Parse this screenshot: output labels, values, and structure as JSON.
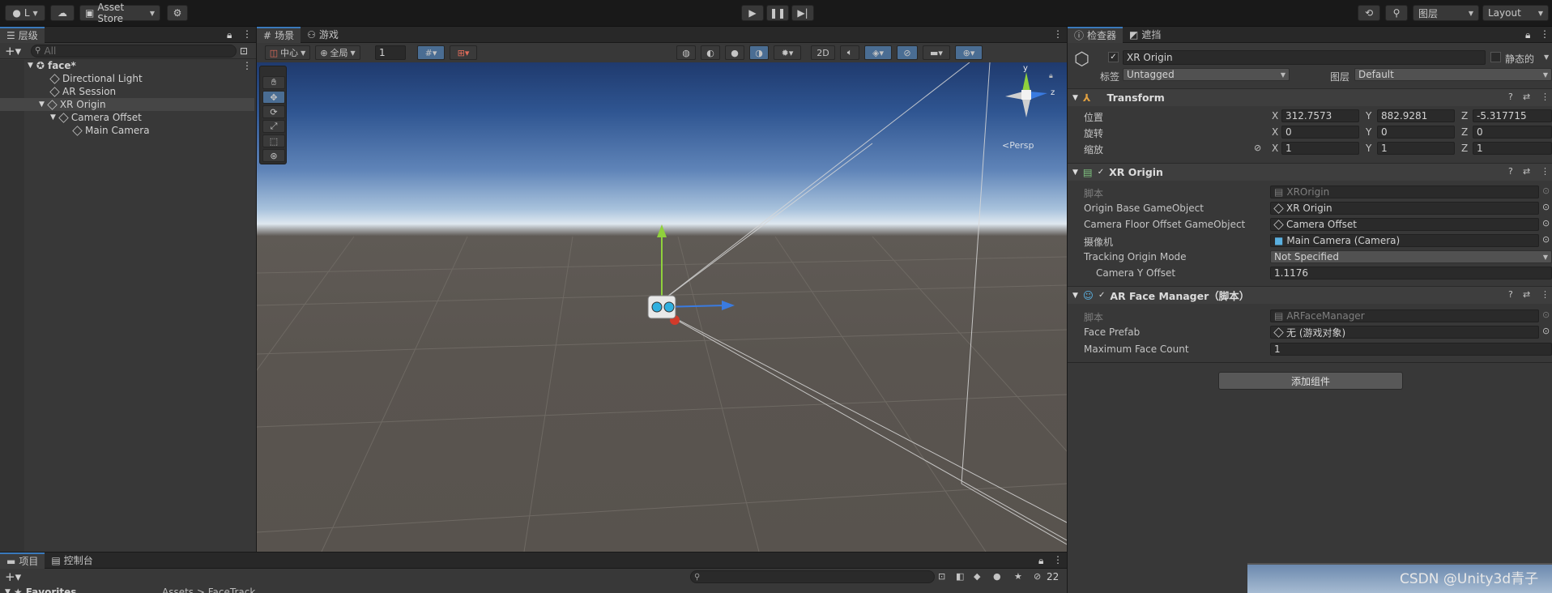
{
  "toolbar": {
    "account": "L",
    "asset_store": "Asset Store",
    "layers": "图层",
    "layout": "Layout"
  },
  "hierarchy": {
    "tab": "层级",
    "search_placeholder": "All",
    "scene": "face*",
    "items": [
      {
        "label": "Directional Light"
      },
      {
        "label": "AR Session"
      },
      {
        "label": "XR Origin"
      },
      {
        "label": "Camera Offset"
      },
      {
        "label": "Main Camera"
      }
    ]
  },
  "scene_view": {
    "tab_scene": "场景",
    "tab_game": "游戏",
    "pivot": "中心",
    "global": "全局",
    "grid_value": "1",
    "mode_2d": "2D",
    "gizmo_y": "y",
    "gizmo_z": "z",
    "persp": "<Persp"
  },
  "inspector": {
    "tab_inspector": "检查器",
    "tab_occlusion": "遮挡",
    "object_name": "XR Origin",
    "static_label": "静态的",
    "tag_label": "标签",
    "tag_value": "Untagged",
    "layer_label": "图层",
    "layer_value": "Default",
    "transform": {
      "title": "Transform",
      "position_label": "位置",
      "rotation_label": "旋转",
      "scale_label": "缩放",
      "position": {
        "x": "312.7573",
        "y": "882.9281",
        "z": "-5.317715"
      },
      "rotation": {
        "x": "0",
        "y": "0",
        "z": "0"
      },
      "scale": {
        "x": "1",
        "y": "1",
        "z": "1"
      }
    },
    "xr_origin": {
      "title": "XR Origin",
      "script_label": "脚本",
      "script_value": "XROrigin",
      "origin_base_label": "Origin Base GameObject",
      "origin_base_value": "XR Origin",
      "camera_floor_label": "Camera Floor Offset GameObject",
      "camera_floor_value": "Camera Offset",
      "camera_label": "摄像机",
      "camera_value": "Main Camera (Camera)",
      "tracking_label": "Tracking Origin Mode",
      "tracking_value": "Not Specified",
      "camera_y_label": "Camera Y Offset",
      "camera_y_value": "1.1176"
    },
    "ar_face": {
      "title": "AR Face Manager（脚本）",
      "script_label": "脚本",
      "script_value": "ARFaceManager",
      "face_prefab_label": "Face Prefab",
      "face_prefab_value": "无 (游戏对象)",
      "max_face_label": "Maximum Face Count",
      "max_face_value": "1"
    },
    "add_component": "添加组件"
  },
  "project": {
    "tab_project": "项目",
    "tab_console": "控制台",
    "favorites": "Favorites",
    "breadcrumb": "Assets > FaceTrack",
    "hidden_count": "22"
  },
  "watermark": "CSDN @Unity3d青子",
  "colors": {
    "accent": "#3a79bb",
    "panel": "#383838",
    "toolbar": "#191919"
  }
}
